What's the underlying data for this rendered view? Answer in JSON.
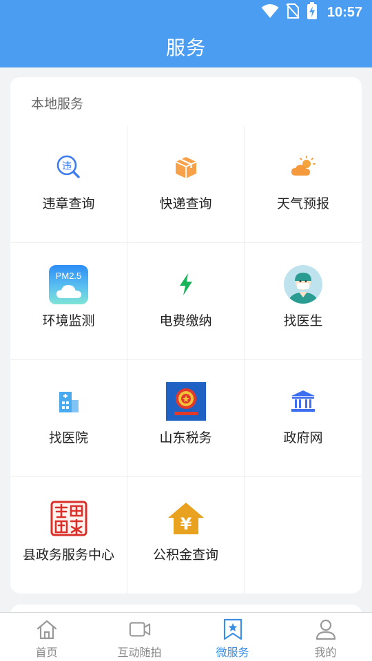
{
  "status_bar": {
    "time": "10:57"
  },
  "header": {
    "title": "服务"
  },
  "local_services": {
    "title": "本地服务",
    "items": [
      {
        "label": "违章查询",
        "icon": "violation-search-icon"
      },
      {
        "label": "快递查询",
        "icon": "package-icon"
      },
      {
        "label": "天气预报",
        "icon": "weather-icon"
      },
      {
        "label": "环境监测",
        "icon": "pm25-icon",
        "badge": "PM2.5"
      },
      {
        "label": "电费缴纳",
        "icon": "lightning-icon"
      },
      {
        "label": "找医生",
        "icon": "doctor-avatar-icon"
      },
      {
        "label": "找医院",
        "icon": "hospital-icon"
      },
      {
        "label": "山东税务",
        "icon": "tax-emblem-icon"
      },
      {
        "label": "政府网",
        "icon": "government-building-icon"
      },
      {
        "label": "县政务服务中心",
        "icon": "seal-stamp-icon"
      },
      {
        "label": "公积金查询",
        "icon": "housing-fund-icon",
        "glyph": "¥"
      }
    ]
  },
  "bottom_nav": {
    "items": [
      {
        "label": "首页",
        "icon": "home-icon"
      },
      {
        "label": "互动随拍",
        "icon": "video-camera-icon"
      },
      {
        "label": "微服务",
        "icon": "bookmark-star-icon",
        "active": true
      },
      {
        "label": "我的",
        "icon": "user-icon"
      }
    ]
  },
  "colors": {
    "header": "#4a9df0",
    "active_tab": "#3a8ee6",
    "icon_blue": "#3d7cf0",
    "icon_orange": "#f59a3c",
    "icon_green": "#19b35a"
  }
}
